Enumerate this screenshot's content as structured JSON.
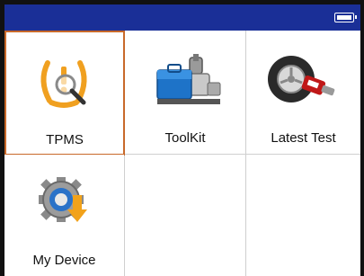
{
  "status": {
    "battery_icon": "battery-full-icon"
  },
  "tiles": [
    {
      "label": "TPMS",
      "icon": "tpms-warning-icon",
      "selected": true
    },
    {
      "label": "ToolKit",
      "icon": "toolkit-icon"
    },
    {
      "label": "Latest Test",
      "icon": "latest-test-icon"
    },
    {
      "label": "My Device",
      "icon": "my-device-icon"
    }
  ],
  "colors": {
    "statusbar": "#1a2f97",
    "selection_border": "#c8692a",
    "tpms_orange": "#f0a020"
  }
}
